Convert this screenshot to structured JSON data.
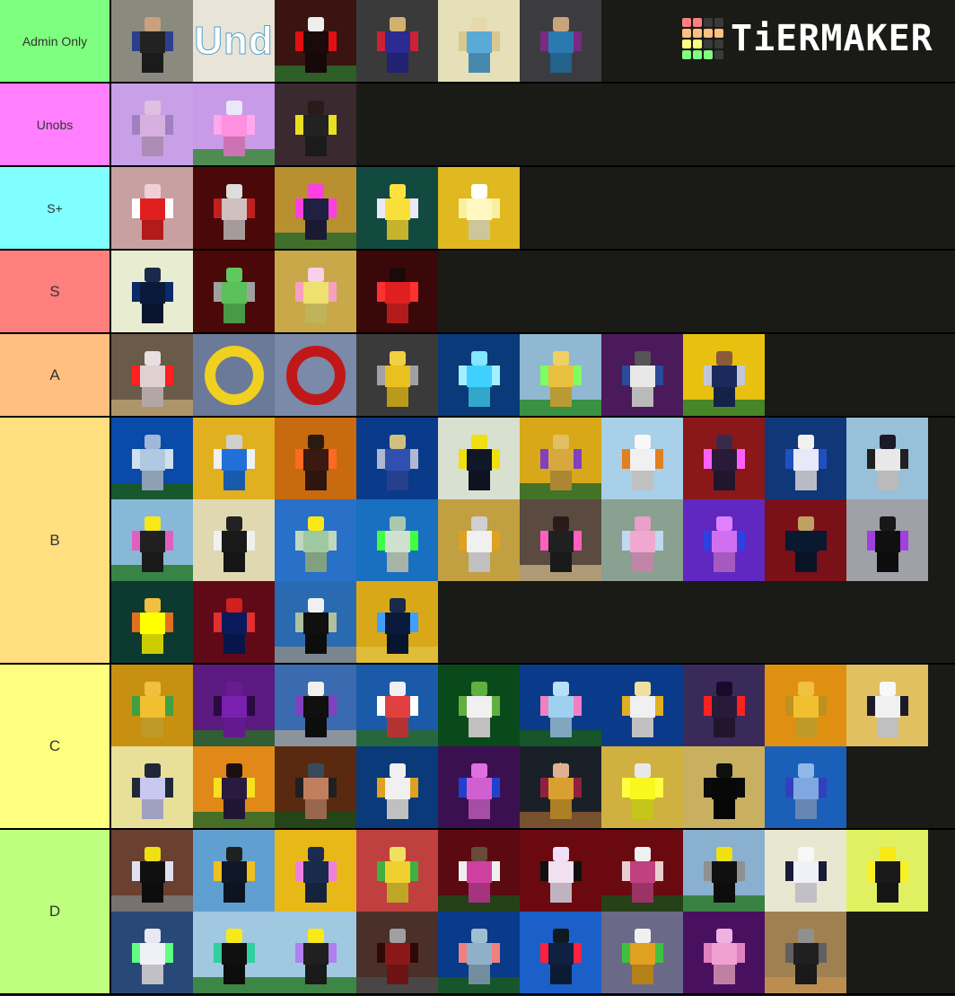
{
  "brand": {
    "logo_text": "TiERMAKER",
    "logo_grid_colors": [
      "#ff7f7f",
      "#ff7f7f",
      "#3a3a3a",
      "#3a3a3a",
      "#ffbf7f",
      "#ffbf7f",
      "#ffbf7f",
      "#ffbf7f",
      "#ffff7f",
      "#ffff7f",
      "#3a3a3a",
      "#3a3a3a",
      "#7fff7f",
      "#7fff7f",
      "#7fff7f",
      "#3a3a3a"
    ]
  },
  "tiers": [
    {
      "label": "Admin Only",
      "color": "#7fff7f",
      "label_size": "small",
      "items": [
        {
          "bg": "#8a8a7e",
          "kind": "fig",
          "body": "#222",
          "head": "#c9a27d",
          "extra": "#2d3e8c"
        },
        {
          "bg": "#e8e4d8",
          "kind": "text",
          "text": "Und"
        },
        {
          "bg": "#3a1410",
          "kind": "fig",
          "body": "#1a0a0a",
          "head": "#eee",
          "extra": "#e01010",
          "ground": "#2e6b2a"
        },
        {
          "bg": "#3a3a3a",
          "kind": "fig",
          "body": "#2b2b90",
          "head": "#d2b070",
          "extra": "#c23"
        },
        {
          "bg": "#e6e0b8",
          "kind": "fig",
          "body": "#5aaad8",
          "head": "#e8d8b0",
          "extra": "#d8c890"
        },
        {
          "bg": "#3c3c40",
          "kind": "fig",
          "body": "#2a7ab0",
          "head": "#c8a47c",
          "extra": "#7a2a80"
        }
      ]
    },
    {
      "label": "Unobs",
      "color": "#ff7fff",
      "label_size": "small",
      "items": [
        {
          "bg": "#c8a0e8",
          "kind": "fig",
          "body": "#d8b0e0",
          "head": "#e0c0e0",
          "extra": "#a080c0"
        },
        {
          "bg": "#c89ae8",
          "kind": "fig",
          "body": "#ff90e0",
          "head": "#e8e8f8",
          "extra": "#ffa8ec",
          "ground": "#3a8a3a"
        },
        {
          "bg": "#3a2a30",
          "kind": "fig",
          "body": "#222",
          "head": "#2a1a1a",
          "extra": "#e8e020"
        }
      ]
    },
    {
      "label": "S+",
      "color": "#7fffff",
      "label_size": "small",
      "items": [
        {
          "bg": "#c8a0a0",
          "kind": "fig",
          "body": "#e02020",
          "head": "#f0d0d8",
          "extra": "#ffffff"
        },
        {
          "bg": "#4a0808",
          "kind": "fig",
          "body": "#d0c0c0",
          "head": "#ddd",
          "extra": "#c02020"
        },
        {
          "bg": "#b89030",
          "kind": "fig",
          "body": "#202040",
          "head": "#ff40e0",
          "extra": "#ff40e0",
          "ground": "#2a6a2a"
        },
        {
          "bg": "#124a40",
          "kind": "fig",
          "body": "#f8e038",
          "head": "#ffe040",
          "extra": "#e8e8f8"
        },
        {
          "bg": "#e0b820",
          "kind": "fig",
          "body": "#fff8c0",
          "head": "#ffffff",
          "extra": "#f8f0a0"
        }
      ]
    },
    {
      "label": "S",
      "color": "#ff7f7f",
      "label_size": "big",
      "items": [
        {
          "bg": "#e8ecd0",
          "kind": "fig",
          "body": "#0a1a3a",
          "head": "#1a2a4a",
          "extra": "#0a2a6a"
        },
        {
          "bg": "#4a0808",
          "kind": "fig",
          "body": "#5ac05a",
          "head": "#60c860",
          "extra": "#a0a0a0"
        },
        {
          "bg": "#c8a848",
          "kind": "fig",
          "body": "#f0e070",
          "head": "#f8d0e8",
          "extra": "#f8a0c0"
        },
        {
          "bg": "#3a0808",
          "kind": "fig",
          "body": "#e02020",
          "head": "#1a0a0a",
          "extra": "#ff3030"
        }
      ]
    },
    {
      "label": "A",
      "color": "#ffbf7f",
      "label_size": "big",
      "items": [
        {
          "bg": "#6a5a48",
          "kind": "fig",
          "body": "#e0d0d0",
          "head": "#e8e0e0",
          "extra": "#ff2020",
          "ground": "#b8a070"
        },
        {
          "bg": "#6a7a98",
          "kind": "ring",
          "ring": "#f0d020"
        },
        {
          "bg": "#7a8aa8",
          "kind": "ring",
          "ring": "#c01818"
        },
        {
          "bg": "#3a3a3a",
          "kind": "fig",
          "body": "#e8c020",
          "head": "#f0d040",
          "extra": "#a0a0a8"
        },
        {
          "bg": "#0a3a7a",
          "kind": "fig",
          "body": "#40d0ff",
          "head": "#80e8ff",
          "extra": "#a0f0ff"
        },
        {
          "bg": "#90b8d0",
          "kind": "fig",
          "body": "#e8c040",
          "head": "#f0d060",
          "extra": "#80ff60",
          "ground": "#2a8a2a"
        },
        {
          "bg": "#4a1a5a",
          "kind": "fig",
          "body": "#e8e8e8",
          "head": "#555",
          "extra": "#2a4a9a"
        },
        {
          "bg": "#e8c010",
          "kind": "fig",
          "body": "#1a2a5a",
          "head": "#8a5a3a",
          "extra": "#c0c8d8",
          "ground": "#2a7a2a"
        }
      ]
    },
    {
      "label": "B",
      "color": "#ffdf7f",
      "label_size": "big",
      "items": [
        {
          "bg": "#0a4aa8",
          "kind": "fig",
          "body": "#b0c8e0",
          "head": "#a0b8d8",
          "extra": "#d0e0f0",
          "ground": "#1a5a1a"
        },
        {
          "bg": "#e0b020",
          "kind": "fig",
          "body": "#2070d8",
          "head": "#d0d0d0",
          "extra": "#f0f0f0"
        },
        {
          "bg": "#c86a10",
          "kind": "fig",
          "body": "#3a1a10",
          "head": "#2a1a10",
          "extra": "#ff6a20"
        },
        {
          "bg": "#0a3a8a",
          "kind": "fig",
          "body": "#3050b0",
          "head": "#d0c080",
          "extra": "#b0b8d0"
        },
        {
          "bg": "#d8e0d0",
          "kind": "fig",
          "body": "#101828",
          "head": "#f0e010",
          "extra": "#f0e010"
        },
        {
          "bg": "#d8a818",
          "kind": "fig",
          "body": "#d8a840",
          "head": "#e0c060",
          "extra": "#8040c0",
          "ground": "#2a6a2a"
        },
        {
          "bg": "#a8d0e8",
          "kind": "fig",
          "body": "#f0f0f0",
          "head": "#f8f8f8",
          "extra": "#e08020"
        },
        {
          "bg": "#8a1818",
          "kind": "fig",
          "body": "#2a1a3a",
          "head": "#3a2a4a",
          "extra": "#ff60ff"
        },
        {
          "bg": "#103878",
          "kind": "fig",
          "body": "#e8e8f8",
          "head": "#f0f0f0",
          "extra": "#2050c0"
        },
        {
          "bg": "#98c0d8",
          "kind": "fig",
          "body": "#e8e8e8",
          "head": "#1a1a2a",
          "extra": "#202020"
        },
        {
          "bg": "#88b8d8",
          "kind": "fig",
          "body": "#202020",
          "head": "#f8e818",
          "extra": "#e060c0",
          "ground": "#2a7a2a"
        },
        {
          "bg": "#e0d8b0",
          "kind": "fig",
          "body": "#1a1a1a",
          "head": "#222",
          "extra": "#f0f0f0"
        },
        {
          "bg": "#2870c8",
          "kind": "fig",
          "body": "#a0c8a0",
          "head": "#f8e818",
          "extra": "#c0d8c0"
        },
        {
          "bg": "#1a70c0",
          "kind": "fig",
          "body": "#d0e0d0",
          "head": "#a8c8b0",
          "extra": "#40ff40"
        },
        {
          "bg": "#c0a040",
          "kind": "fig",
          "body": "#f0f0f0",
          "head": "#d0d0d0",
          "extra": "#e0a020"
        },
        {
          "bg": "#5a4a40",
          "kind": "fig",
          "body": "#202020",
          "head": "#2a1a1a",
          "extra": "#ff60c0",
          "ground": "#c0a880"
        },
        {
          "bg": "#8aa090",
          "kind": "fig",
          "body": "#f0a8d0",
          "head": "#e8a0c8",
          "extra": "#c0d8f0"
        },
        {
          "bg": "#6028c0",
          "kind": "fig",
          "body": "#d070f0",
          "head": "#e080ff",
          "extra": "#3040e0"
        },
        {
          "bg": "#7a1018",
          "kind": "fig",
          "body": "#0a1830",
          "head": "#c0a060",
          "extra": "#0a1830"
        },
        {
          "bg": "#a0a0a8",
          "kind": "fig",
          "body": "#101010",
          "head": "#181818",
          "extra": "#a040e0"
        },
        {
          "bg": "#0c3a30",
          "kind": "fig",
          "body": "#ffff00",
          "head": "#f0c040",
          "extra": "#e07020"
        },
        {
          "bg": "#600a18",
          "kind": "fig",
          "body": "#0a1a5a",
          "head": "#d02020",
          "extra": "#e03030"
        },
        {
          "bg": "#2a6ab0",
          "kind": "fig",
          "body": "#101010",
          "head": "#f0f0f0",
          "extra": "#b0c0a0",
          "ground": "#8a8a8a"
        },
        {
          "bg": "#d8a818",
          "kind": "fig",
          "body": "#0a1a3a",
          "head": "#1a2a4a",
          "extra": "#40a0ff",
          "ground": "#e0c040"
        }
      ]
    },
    {
      "label": "C",
      "color": "#ffff7f",
      "label_size": "big",
      "items": [
        {
          "bg": "#c89010",
          "kind": "fig",
          "body": "#f0c030",
          "head": "#f0c040",
          "extra": "#40a040"
        },
        {
          "bg": "#5a1a80",
          "kind": "fig",
          "body": "#7a20b0",
          "head": "#6a1a90",
          "extra": "#2a0a40",
          "ground": "#2a6a2a"
        },
        {
          "bg": "#3a6ab0",
          "kind": "fig",
          "body": "#101010",
          "head": "#f0f0f0",
          "extra": "#8040c0",
          "ground": "#9a9a9a"
        },
        {
          "bg": "#1a5aa8",
          "kind": "fig",
          "body": "#e04040",
          "head": "#f0f0f0",
          "extra": "#ffffff",
          "ground": "#2a6a2a"
        },
        {
          "bg": "#0a4a1a",
          "kind": "fig",
          "body": "#f0f0f0",
          "head": "#60b040",
          "extra": "#60b040"
        },
        {
          "bg": "#0a3a8a",
          "kind": "fig",
          "body": "#a0d0f0",
          "head": "#b8e0f8",
          "extra": "#f080c0",
          "ground": "#1a5a1a"
        },
        {
          "bg": "#0a3a8a",
          "kind": "fig",
          "body": "#f0f0f0",
          "head": "#f0e0a0",
          "extra": "#e0b020"
        },
        {
          "bg": "#3a2a5a",
          "kind": "fig",
          "body": "#2a1a3a",
          "head": "#1a0a2a",
          "extra": "#ff2020"
        },
        {
          "bg": "#e09010",
          "kind": "fig",
          "body": "#f0c030",
          "head": "#f0c040",
          "extra": "#c09020"
        },
        {
          "bg": "#e0c060",
          "kind": "fig",
          "body": "#f0f0f0",
          "head": "#f8f8f8",
          "extra": "#1a1a2a"
        },
        {
          "bg": "#e8e098",
          "kind": "fig",
          "body": "#c8c8f0",
          "head": "#202838",
          "extra": "#202838"
        },
        {
          "bg": "#e08818",
          "kind": "fig",
          "body": "#2a1a40",
          "head": "#1a1010",
          "extra": "#f8e020",
          "ground": "#2a6a2a"
        },
        {
          "bg": "#5a2a10",
          "kind": "fig",
          "body": "#c08060",
          "head": "#3a4a5a",
          "extra": "#202020",
          "ground": "#1a4a1a"
        },
        {
          "bg": "#0a3a7a",
          "kind": "fig",
          "body": "#f0f0f0",
          "head": "#f0f0f0",
          "extra": "#e0a020"
        },
        {
          "bg": "#3a1050",
          "kind": "fig",
          "body": "#d060d0",
          "head": "#e070e0",
          "extra": "#2040d0"
        },
        {
          "bg": "#1a2028",
          "kind": "fig",
          "body": "#d8a030",
          "head": "#e0b090",
          "extra": "#902040",
          "ground": "#8a5a30",
          "label": "ok."
        },
        {
          "bg": "#d0b040",
          "kind": "fig",
          "body": "#f8f820",
          "head": "#e8e8e8",
          "extra": "#ffff40"
        },
        {
          "bg": "#c8b060",
          "kind": "fig",
          "body": "#080808",
          "head": "#101010",
          "extra": "#0a0a0a"
        },
        {
          "bg": "#1a60b8",
          "kind": "fig",
          "body": "#80a8e0",
          "head": "#90b8e8",
          "extra": "#3040c0"
        }
      ]
    },
    {
      "label": "D",
      "color": "#bfff7f",
      "label_size": "big",
      "items": [
        {
          "bg": "#6a4030",
          "kind": "fig",
          "body": "#101010",
          "head": "#f0e010",
          "extra": "#e0e0f0",
          "ground": "#7a7a7a"
        },
        {
          "bg": "#60a0d0",
          "kind": "fig",
          "body": "#101828",
          "head": "#202020",
          "extra": "#f0c020"
        },
        {
          "bg": "#e8b818",
          "kind": "fig",
          "body": "#1a2a4a",
          "head": "#1a2a50",
          "extra": "#f080e0"
        },
        {
          "bg": "#c04040",
          "kind": "fig",
          "body": "#f0d030",
          "head": "#f0e060",
          "extra": "#40b040"
        },
        {
          "bg": "#5a0a10",
          "kind": "fig",
          "body": "#d040a0",
          "head": "#6a4a3a",
          "extra": "#f0f0f0",
          "ground": "#1a4a1a"
        },
        {
          "bg": "#6a0a10",
          "kind": "fig",
          "body": "#f0e0f0",
          "head": "#f0e0f8",
          "extra": "#101010"
        },
        {
          "bg": "#6a0a10",
          "kind": "fig",
          "body": "#c04080",
          "head": "#f0f0f0",
          "extra": "#e8d0d0",
          "ground": "#1a4a1a"
        },
        {
          "bg": "#8ab0d0",
          "kind": "fig",
          "body": "#101010",
          "head": "#f0e010",
          "extra": "#909090",
          "ground": "#2a7a2a"
        },
        {
          "bg": "#e8e8d0",
          "kind": "fig",
          "body": "#f0f0f8",
          "head": "#f8f8f8",
          "extra": "#1a1a3a"
        },
        {
          "bg": "#e0f060",
          "kind": "fig",
          "body": "#1a1a1a",
          "head": "#f8e818",
          "extra": "#f8f020"
        },
        {
          "bg": "#284878",
          "kind": "fig",
          "body": "#f0f0f8",
          "head": "#e8e8f0",
          "extra": "#60ff80"
        },
        {
          "bg": "#a0c8e0",
          "kind": "fig",
          "body": "#101010",
          "head": "#f8e818",
          "extra": "#30d0a0",
          "ground": "#2a7a2a"
        },
        {
          "bg": "#a0c8e0",
          "kind": "fig",
          "body": "#202020",
          "head": "#f8e818",
          "extra": "#b080f0",
          "ground": "#2a7a2a"
        },
        {
          "bg": "#4a3028",
          "kind": "fig",
          "body": "#8a1818",
          "head": "#a0a0a0",
          "extra": "#300808",
          "ground": "#4a4a4a"
        },
        {
          "bg": "#0a3a8a",
          "kind": "fig",
          "body": "#90b0c8",
          "head": "#a0c0d0",
          "extra": "#f08080",
          "ground": "#1a5a1a"
        },
        {
          "bg": "#1a60c8",
          "kind": "fig",
          "body": "#102040",
          "head": "#101820",
          "extra": "#ff2040"
        },
        {
          "bg": "#6a6a88",
          "kind": "fig",
          "body": "#e0a020",
          "head": "#f0f0f0",
          "extra": "#40c040"
        },
        {
          "bg": "#4a1060",
          "kind": "fig",
          "body": "#f0a0d0",
          "head": "#f0b0e0",
          "extra": "#e080c0"
        },
        {
          "bg": "#a08050",
          "kind": "fig",
          "body": "#202020",
          "head": "#909090",
          "extra": "#606060",
          "ground": "#c09050"
        }
      ]
    }
  ]
}
